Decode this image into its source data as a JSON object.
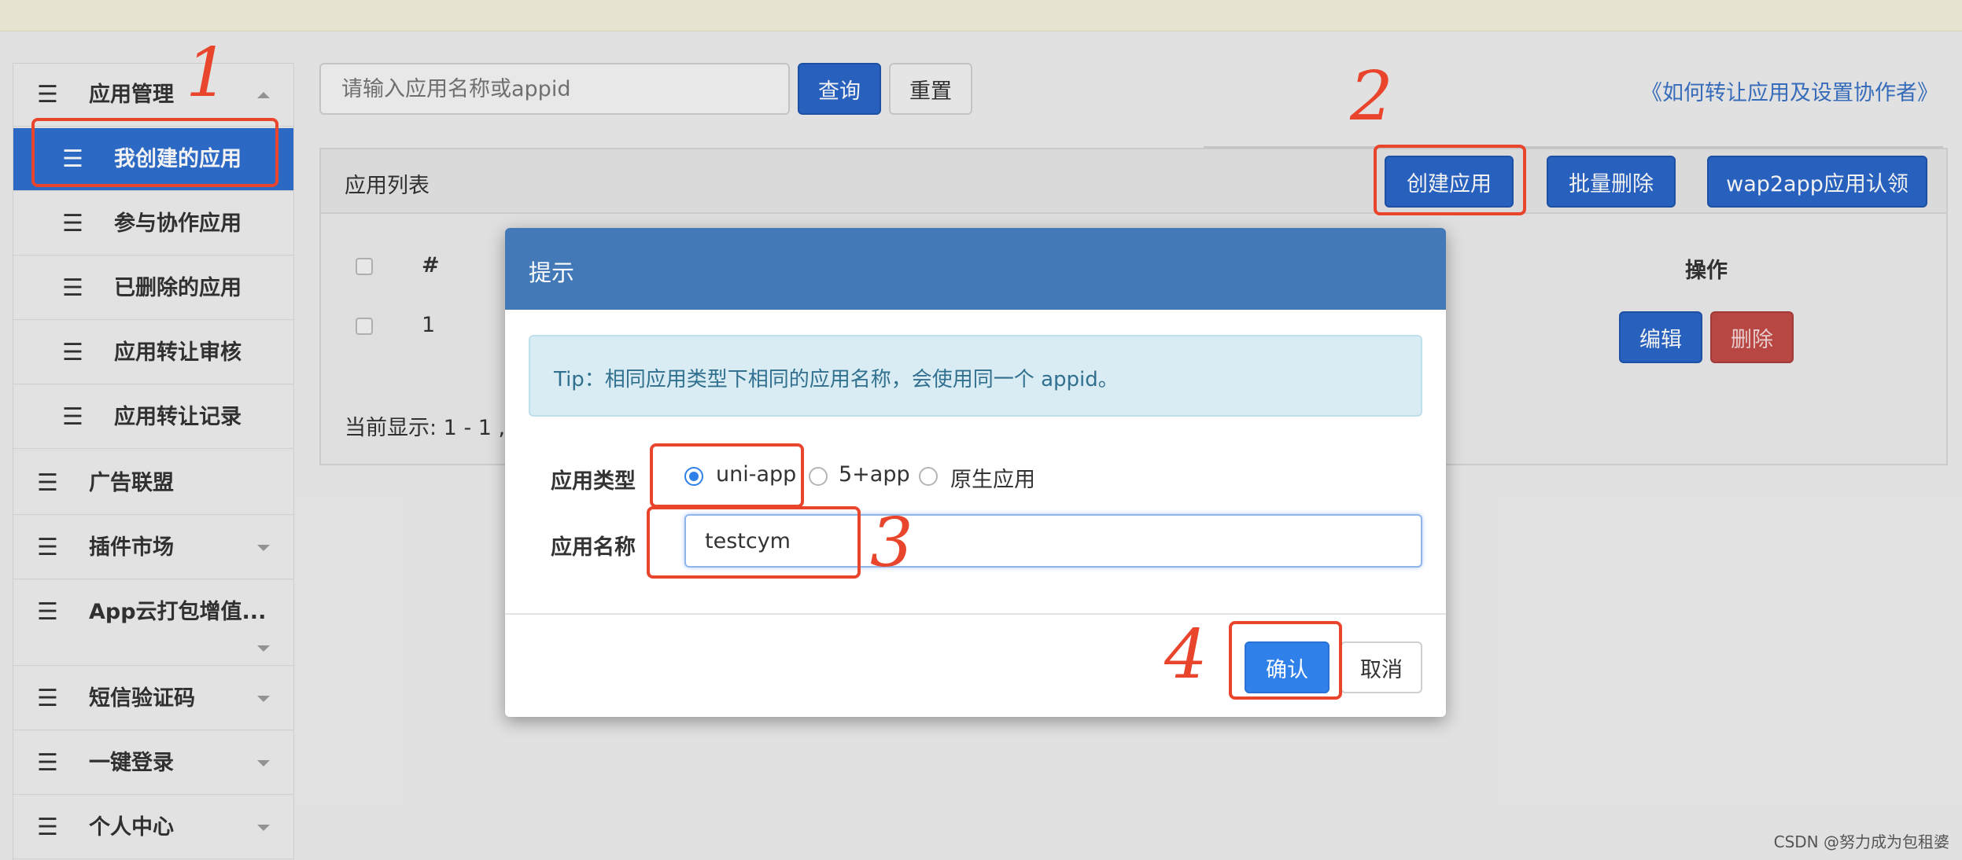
{
  "sidebar": {
    "app_manage": "应用管理",
    "my_apps": "我创建的应用",
    "collab_apps": "参与协作应用",
    "deleted_apps": "已删除的应用",
    "transfer_review": "应用转让审核",
    "transfer_records": "应用转让记录",
    "ad_alliance": "广告联盟",
    "plugin_market": "插件市场",
    "cloud_pack": "App云打包增值...",
    "sms_code": "短信验证码",
    "one_click_login": "一键登录",
    "user_center": "个人中心"
  },
  "search": {
    "placeholder": "请输入应用名称或appid",
    "query_label": "查询",
    "reset_label": "重置"
  },
  "help_link": "《如何转让应用及设置协作者》",
  "panel": {
    "title": "应用列表",
    "create_label": "创建应用",
    "batch_delete_label": "批量删除",
    "wap2app_label": "wap2app应用认领",
    "headers": {
      "index": "#",
      "actions": "操作"
    },
    "rows": [
      {
        "index": "1",
        "edit_label": "编辑",
        "delete_label": "删除"
      }
    ],
    "page_info": "当前显示: 1 - 1 ,"
  },
  "modal": {
    "title": "提示",
    "tip": "Tip：相同应用类型下相同的应用名称，会使用同一个 appid。",
    "type_label": "应用类型",
    "options": [
      "uni-app",
      "5+app",
      "原生应用"
    ],
    "selected_option": "uni-app",
    "name_label": "应用名称",
    "name_value": "testcym",
    "confirm_label": "确认",
    "cancel_label": "取消"
  },
  "annotations": [
    "1",
    "2",
    "3",
    "4"
  ],
  "watermark": "CSDN @努力成为包租婆",
  "colors": {
    "primary": "#2a66c8",
    "modal_header": "#4479b7",
    "danger": "#c24a47",
    "annotation": "#e8452c",
    "tip_bg": "#d9ecf3"
  }
}
